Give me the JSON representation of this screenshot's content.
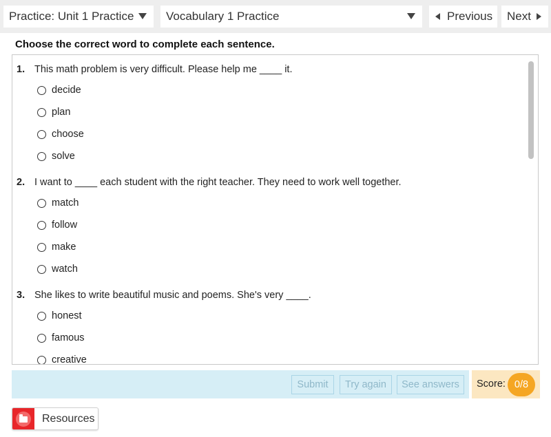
{
  "header": {
    "unit_select": "Practice: Unit 1 Practice",
    "activity_select": "Vocabulary 1 Practice",
    "previous_label": "Previous",
    "next_label": "Next"
  },
  "instructions": "Choose the correct word to complete each sentence.",
  "questions": [
    {
      "number": "1.",
      "text": "This math problem is very difficult. Please help me ____ it.",
      "options": [
        "decide",
        "plan",
        "choose",
        "solve"
      ]
    },
    {
      "number": "2.",
      "text": "I want to ____ each student with the right teacher. They need to work well together.",
      "options": [
        "match",
        "follow",
        "make",
        "watch"
      ]
    },
    {
      "number": "3.",
      "text": "She likes to write beautiful music and poems. She's very ____.",
      "options": [
        "honest",
        "famous",
        "creative"
      ]
    }
  ],
  "actions": {
    "submit_label": "Submit",
    "try_again_label": "Try again",
    "see_answers_label": "See answers"
  },
  "score": {
    "label": "Score:",
    "value": "0/8"
  },
  "resources_label": "Resources",
  "colors": {
    "action_bar": "#d6eef6",
    "score_bg": "#fce7c1",
    "score_pill": "#f5a623",
    "resources_icon": "#e8262a"
  }
}
